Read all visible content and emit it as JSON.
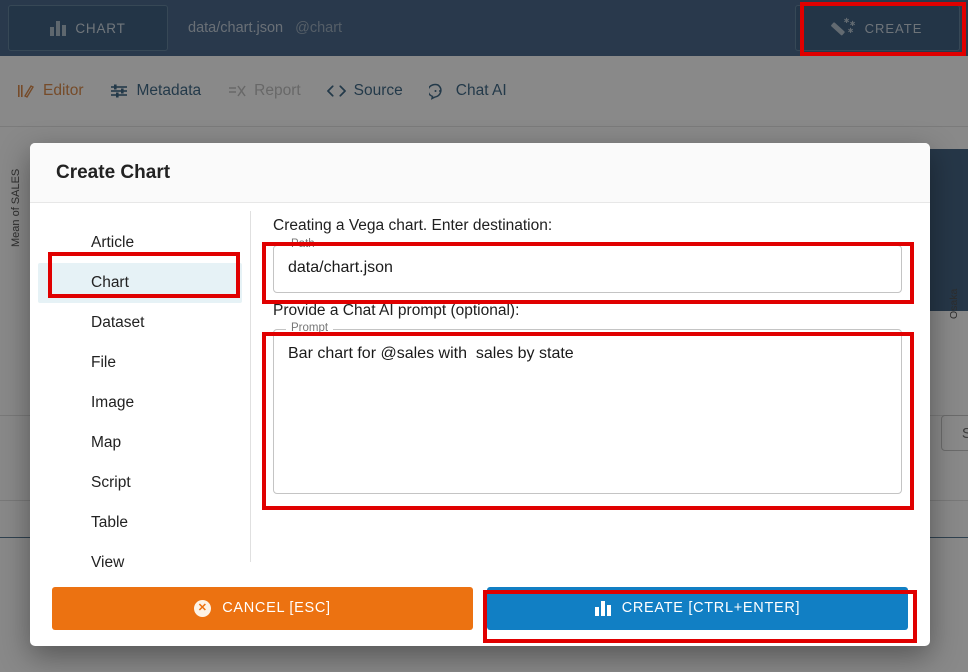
{
  "topbar": {
    "doc_tab": {
      "label": "CHART",
      "icon": "bar-chart-icon"
    },
    "path": "data/chart.json",
    "reference": "@chart",
    "create_button": {
      "label": "CREATE",
      "icon": "magic-wand-icon"
    }
  },
  "navtabs": [
    {
      "label": "Editor",
      "icon": "editor-icon",
      "state": "active"
    },
    {
      "label": "Metadata",
      "icon": "metadata-icon",
      "state": "normal"
    },
    {
      "label": "Report",
      "icon": "report-icon",
      "state": "disabled"
    },
    {
      "label": "Source",
      "icon": "code-icon",
      "state": "normal"
    },
    {
      "label": "Chat AI",
      "icon": "chat-ai-icon",
      "state": "normal"
    }
  ],
  "background": {
    "y_axis_label": "Mean of SALES",
    "x_tick_label": "Osaka",
    "send_button": "Se"
  },
  "modal": {
    "title": "Create Chart",
    "nav_items": [
      {
        "label": "Article",
        "selected": false
      },
      {
        "label": "Chart",
        "selected": true
      },
      {
        "label": "Dataset",
        "selected": false
      },
      {
        "label": "File",
        "selected": false
      },
      {
        "label": "Image",
        "selected": false
      },
      {
        "label": "Map",
        "selected": false
      },
      {
        "label": "Script",
        "selected": false
      },
      {
        "label": "Table",
        "selected": false
      },
      {
        "label": "View",
        "selected": false
      }
    ],
    "destination_hint": "Creating a Vega chart. Enter destination:",
    "path_field": {
      "legend": "Path",
      "value": "data/chart.json"
    },
    "prompt_hint": "Provide a Chat AI prompt (optional):",
    "prompt_field": {
      "legend": "Prompt",
      "value": "Bar chart for @sales with  sales by state"
    },
    "cancel_button": {
      "label": "CANCEL [ESC]",
      "icon": "x-circle-icon"
    },
    "create_button": {
      "label": "CREATE [CTRL+ENTER]",
      "icon": "bar-chart-icon"
    }
  },
  "colors": {
    "header_navy": "#2c4f78",
    "tab_navy": "#1e456e",
    "accent_orange": "#d4762a",
    "link_blue": "#1d4f72",
    "cancel_orange": "#ec7211",
    "create_blue": "#117fc4",
    "selected_row": "#e6f2f6",
    "highlight_red": "#e00000",
    "bar_navy": "#25496f"
  }
}
